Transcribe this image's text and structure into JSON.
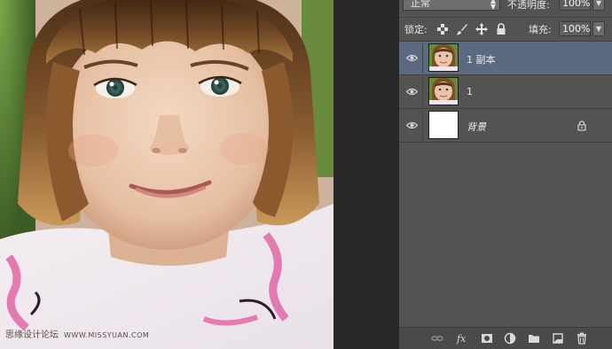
{
  "watermark": {
    "label": "思缘设计论坛",
    "site": "WWW.MISSYUAN.COM"
  },
  "layers_panel": {
    "blend_mode": "正常",
    "opacity_label": "不透明度:",
    "opacity_value": "100%",
    "lock_label": "锁定:",
    "fill_label": "填充:",
    "fill_value": "100%",
    "layers": [
      {
        "name": "1 副本",
        "selected": true,
        "thumbnail": "photo"
      },
      {
        "name": "1",
        "selected": false,
        "thumbnail": "photo"
      },
      {
        "name": "背景",
        "selected": false,
        "thumbnail": "white",
        "locked": true
      }
    ],
    "footer_icons": [
      "link-icon",
      "fx-icon",
      "mask-icon",
      "adjustment-icon",
      "folder-icon",
      "new-layer-icon",
      "trash-icon"
    ]
  },
  "colors": {
    "panel_bg": "#535353",
    "selected_layer": "#5b6a80",
    "app_bg": "#282828"
  }
}
